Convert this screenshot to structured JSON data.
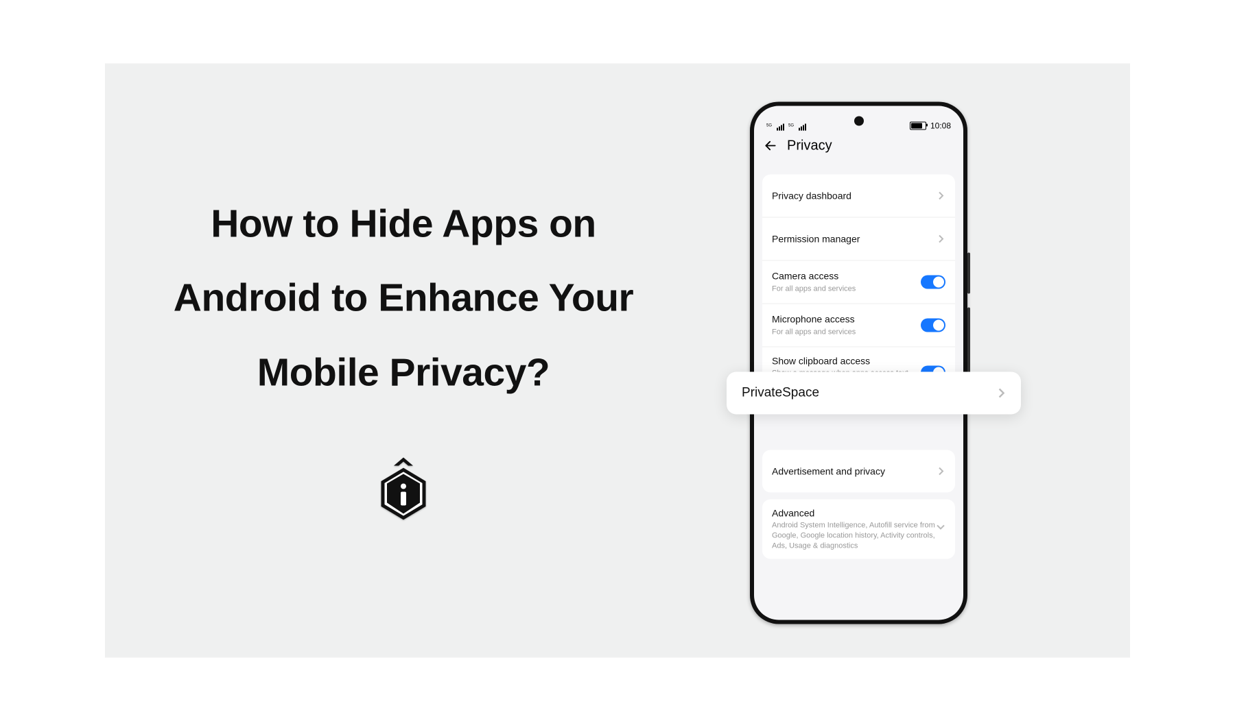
{
  "article": {
    "title_line1": "How to Hide Apps on",
    "title_line2": "Android to Enhance Your",
    "title_line3": "Mobile Privacy?"
  },
  "phone": {
    "status": {
      "network_label": "5G",
      "time": "10:08"
    },
    "page_title": "Privacy",
    "sections": {
      "group1": [
        {
          "title": "Privacy dashboard",
          "sub": null,
          "control": "chevron"
        },
        {
          "title": "Permission manager",
          "sub": null,
          "control": "chevron"
        },
        {
          "title": "Camera access",
          "sub": "For all apps and services",
          "control": "toggle"
        },
        {
          "title": "Microphone access",
          "sub": "For all apps and services",
          "control": "toggle"
        },
        {
          "title": "Show clipboard access",
          "sub": "Show a message when apps access text, images or other content that you've copied",
          "control": "toggle"
        }
      ],
      "floating": {
        "title": "PrivateSpace",
        "control": "chevron"
      },
      "group2": [
        {
          "title": "Advertisement and privacy",
          "sub": null,
          "control": "chevron"
        }
      ],
      "group3": [
        {
          "title": "Advanced",
          "sub": "Android System Intelligence, Autofill service from Google, Google location history, Activity controls, Ads, Usage & diagnostics",
          "control": "chevron-down"
        }
      ]
    }
  }
}
